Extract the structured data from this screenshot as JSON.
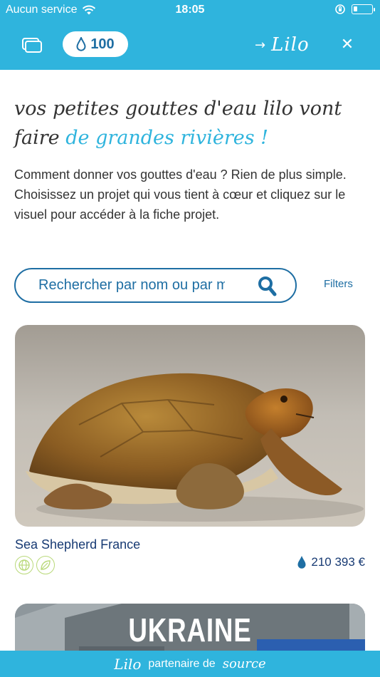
{
  "status_bar": {
    "carrier": "Aucun service",
    "time": "18:05",
    "battery_level": 0.2,
    "icons": [
      "wifi-icon",
      "orientation-lock-icon",
      "battery-icon"
    ]
  },
  "header": {
    "drops_count": "100",
    "logo": "Lilo",
    "icons": [
      "tabs-icon",
      "water-drop-icon",
      "arrow-right-icon",
      "close-icon"
    ]
  },
  "headline": {
    "main": "vos petites gouttes d'eau lilo vont faire",
    "accent": "de grandes rivières !"
  },
  "intro": "Comment donner vos gouttes d'eau ? Rien de plus simple. Choisissez un projet qui vous tient à cœur et cliquez sur le visuel pour accéder à la fiche projet.",
  "search": {
    "placeholder": "Rechercher par nom ou par mot-clé",
    "filters_label": "Filters"
  },
  "projects": [
    {
      "name": "Sea Shepherd France",
      "amount": "210 393 €",
      "image": "sea turtle on sand",
      "category_icons": [
        "globe-icon",
        "leaf-icon"
      ]
    },
    {
      "image_text": "UKRAINE"
    }
  ],
  "footer": {
    "logo": "Lilo",
    "text": "partenaire de",
    "partner": "source"
  },
  "colors": {
    "brand_blue": "#2fb4dd",
    "dark_blue": "#1e6ea3",
    "navy": "#173a73",
    "badge_green": "#b9d97a"
  }
}
